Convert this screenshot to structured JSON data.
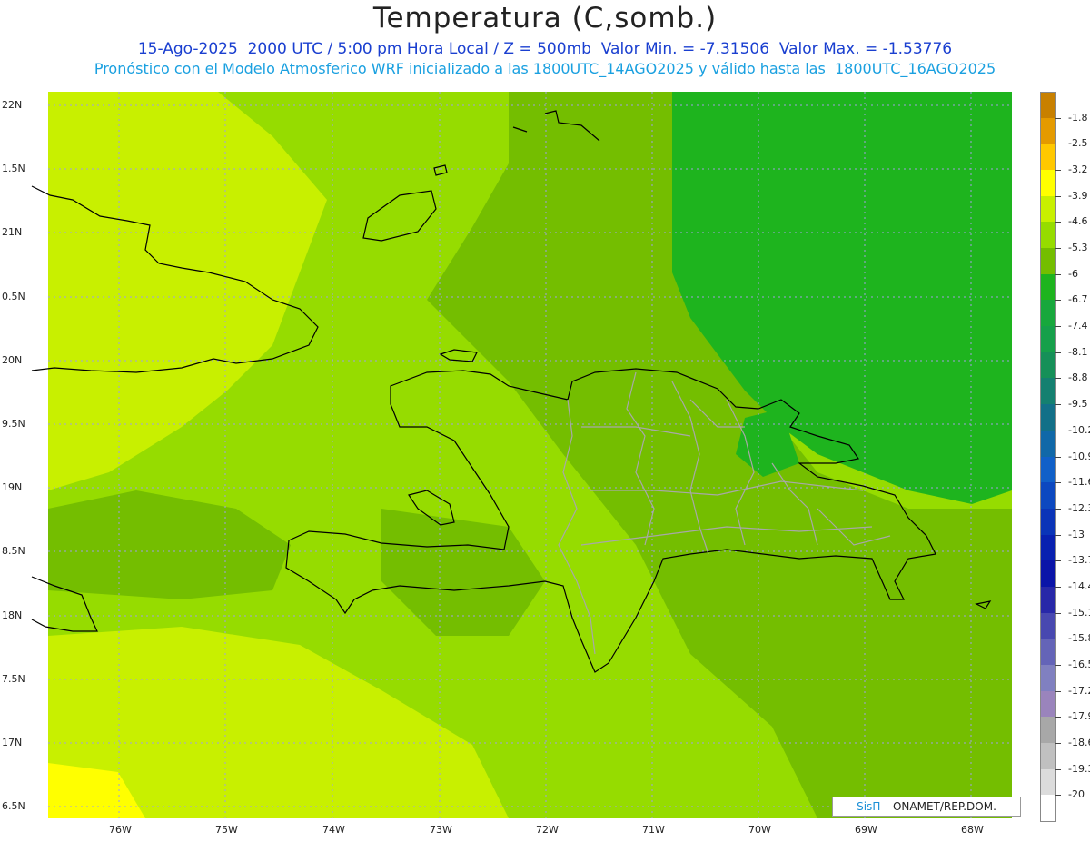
{
  "header": {
    "title": "Temperatura (C,somb.)",
    "line1": "15-Ago-2025  2000 UTC / 5:00 pm Hora Local / Z = 500mb  Valor Min. = -7.31506  Valor Max. = -1.53776",
    "line2": "Pronóstico con el Modelo Atmosferico WRF inicializado a las 1800UTC_14AGO2025 y válido hasta las  1800UTC_16AGO2025"
  },
  "axes": {
    "lat_labels": [
      "22N",
      "1.5N",
      "21N",
      "0.5N",
      "20N",
      "9.5N",
      "19N",
      "8.5N",
      "18N",
      "7.5N",
      "17N",
      "6.5N"
    ],
    "lon_labels": [
      "76W",
      "75W",
      "74W",
      "73W",
      "72W",
      "71W",
      "70W",
      "69W",
      "68W"
    ]
  },
  "colorbar": {
    "labels": [
      "-1.8",
      "-2.5",
      "-3.2",
      "-3.9",
      "-4.6",
      "-5.3",
      "-6",
      "-6.7",
      "-7.4",
      "-8.1",
      "-8.8",
      "-9.5",
      "-10.2",
      "-10.9",
      "-11.6",
      "-12.3",
      "-13",
      "-13.7",
      "-14.4",
      "-15.1",
      "-15.8",
      "-16.5",
      "-17.2",
      "-17.9",
      "-18.6",
      "-19.3",
      "-20"
    ],
    "colors": [
      "#c88000",
      "#e49a00",
      "#ffc800",
      "#ffff00",
      "#c8f000",
      "#96dc00",
      "#74be00",
      "#1eb41e",
      "#18a83c",
      "#16a04a",
      "#169058",
      "#148070",
      "#127088",
      "#1068a8",
      "#1060c8",
      "#0c48c0",
      "#0a34b8",
      "#0820b0",
      "#0a14a8",
      "#2828a8",
      "#4848b0",
      "#6464b8",
      "#8080c0",
      "#9a84bc",
      "#a8a8a8",
      "#c0c0c0",
      "#dcdcdc",
      "#ffffff"
    ]
  },
  "field_colors": {
    "background": "#96dc00",
    "light": "#c8f000",
    "medium": "#74be00",
    "dark": "#1eb41e",
    "yellow": "#ffff00",
    "grid": "#a0a0e0",
    "provinces": "#a8a8a8",
    "coast": "#000000"
  },
  "credit": {
    "logo": "SisΠ",
    "text": "– ONAMET/REP.DOM."
  }
}
